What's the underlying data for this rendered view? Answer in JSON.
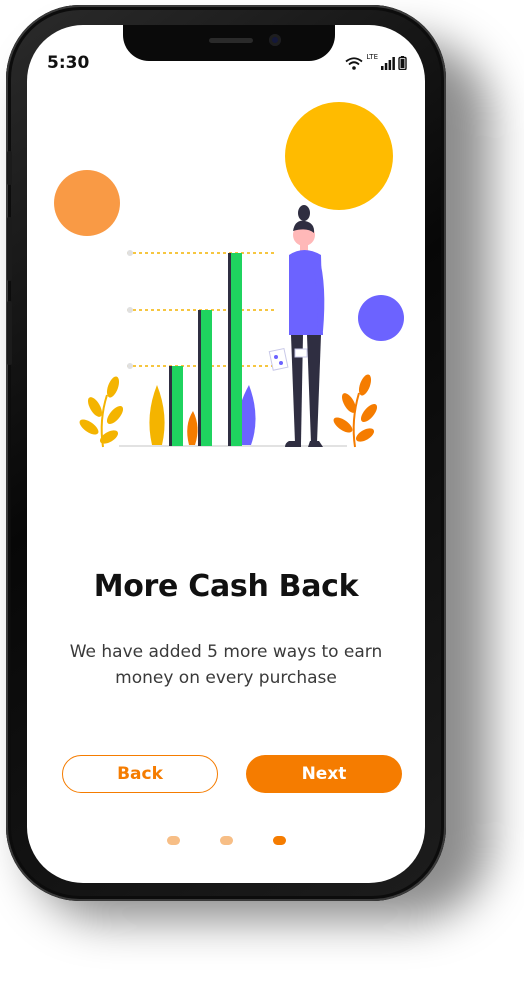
{
  "status_bar": {
    "time": "5:30",
    "network": "LTE",
    "icons": [
      "wifi-icon",
      "signal-icon",
      "battery-icon"
    ]
  },
  "onboarding": {
    "title": "More Cash Back",
    "description": "We have added 5 more ways to earn money on every purchase",
    "back_label": "Back",
    "next_label": "Next",
    "page_indicator": {
      "total": 3,
      "current": 3
    }
  },
  "colors": {
    "accent": "#f57c00",
    "dot_inactive": "#f7be86",
    "chart_green": "#1fd35f",
    "circle_orange": "#f99a45",
    "circle_yellow": "#ffbb00",
    "circle_purple": "#6c63ff",
    "figure_shirt": "#6c63ff"
  }
}
